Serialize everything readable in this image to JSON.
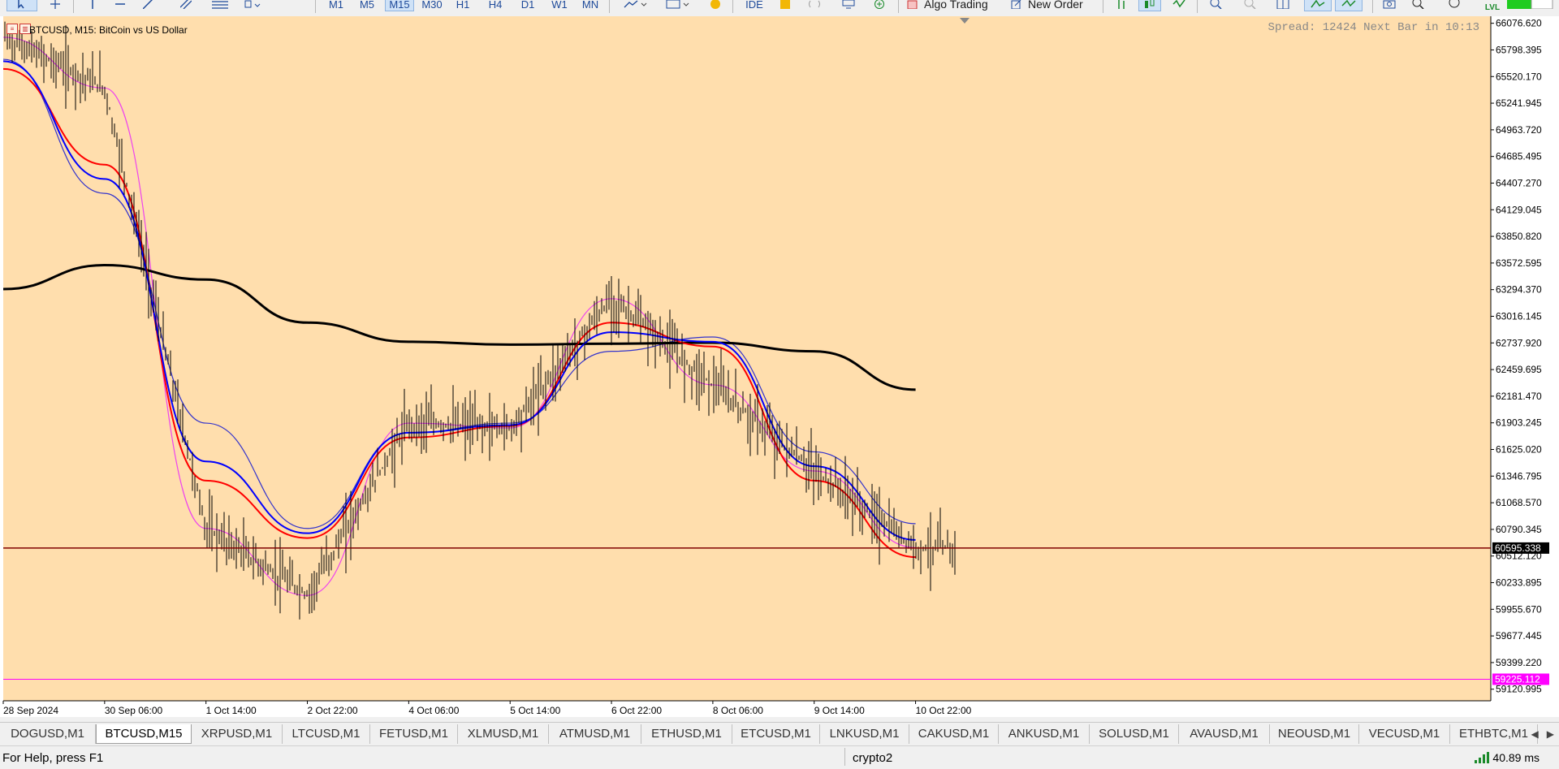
{
  "toolbar": {
    "timeframes": [
      "M1",
      "M5",
      "M15",
      "M30",
      "H1",
      "H4",
      "D1",
      "W1",
      "MN"
    ],
    "active_timeframe": "M15",
    "ide_label": "IDE",
    "algo_trading_label": "Algo Trading",
    "new_order_label": "New Order",
    "lvl_label": "LVL"
  },
  "chart": {
    "title": "BTCUSD, M15:  BitCoin vs US Dollar",
    "spread_text": "Spread: 12424 Next Bar in 10:13",
    "current_price_label": "60595.338",
    "alert_price_label": "59225.112",
    "colors": {
      "background": "#ffdead",
      "price_line": "#800000",
      "alert_line": "#ff00ff",
      "ma_red": "#ff0000",
      "ma_blue": "#0000ff",
      "ma_green": "#008000",
      "ma_black": "#000000",
      "band_blue": "#3333cc",
      "band_magenta": "#ee44ee"
    },
    "price_axis": [
      "66076.620",
      "65798.395",
      "65520.170",
      "65241.945",
      "64963.720",
      "64685.495",
      "64407.270",
      "64129.045",
      "63850.820",
      "63572.595",
      "63294.370",
      "63016.145",
      "62737.920",
      "62459.695",
      "62181.470",
      "61903.245",
      "61625.020",
      "61346.795",
      "61068.570",
      "60790.345",
      "60512.120",
      "60233.895",
      "59955.670",
      "59677.445",
      "59399.220",
      "59120.995"
    ],
    "time_axis": [
      "28 Sep 2024",
      "30 Sep 06:00",
      "1 Oct 14:00",
      "2 Oct 22:00",
      "4 Oct 06:00",
      "5 Oct 14:00",
      "6 Oct 22:00",
      "8 Oct 06:00",
      "9 Oct 14:00",
      "10 Oct 22:00"
    ]
  },
  "chart_data": {
    "type": "line",
    "symbol": "BTCUSD",
    "timeframe": "M15",
    "y_range": [
      59000,
      66150
    ],
    "current_price": 60595.338,
    "alert_level": 59225.112,
    "x": [
      "28 Sep 2024",
      "30 Sep 06:00",
      "1 Oct 14:00",
      "2 Oct 22:00",
      "4 Oct 06:00",
      "5 Oct 14:00",
      "6 Oct 22:00",
      "8 Oct 06:00",
      "9 Oct 14:00",
      "10 Oct 22:00"
    ],
    "series": [
      {
        "values": [
          65930,
          65400,
          60800,
          60100,
          61900,
          61850,
          63200,
          62300,
          61400,
          60600
        ]
      },
      {
        "values": [
          65700,
          64300,
          61900,
          60800,
          61800,
          61900,
          62650,
          62800,
          61600,
          60850
        ]
      },
      {
        "values": [
          63300,
          63550,
          63400,
          62950,
          62750,
          62720,
          62730,
          62740,
          62650,
          62250
        ]
      },
      {
        "values": [
          65600,
          64600,
          61300,
          60700,
          61750,
          61870,
          62950,
          62700,
          61300,
          60500
        ]
      },
      {
        "values": [
          65680,
          64450,
          61500,
          60750,
          61800,
          61880,
          62850,
          62750,
          61450,
          60680
        ]
      }
    ]
  },
  "tabs": {
    "items": [
      "DOGUSD,M1",
      "BTCUSD,M15",
      "XRPUSD,M1",
      "LTCUSD,M1",
      "FETUSD,M1",
      "XLMUSD,M1",
      "ATMUSD,M1",
      "ETHUSD,M1",
      "ETCUSD,M1",
      "LNKUSD,M1",
      "CAKUSD,M1",
      "ANKUSD,M1",
      "SOLUSD,M1",
      "AVAUSD,M1",
      "NEOUSD,M1",
      "VECUSD,M1",
      "ETHBTC,M1"
    ],
    "active_index": 1
  },
  "status": {
    "help": "For Help, press F1",
    "profile": "crypto2",
    "ping": "40.89 ms"
  }
}
